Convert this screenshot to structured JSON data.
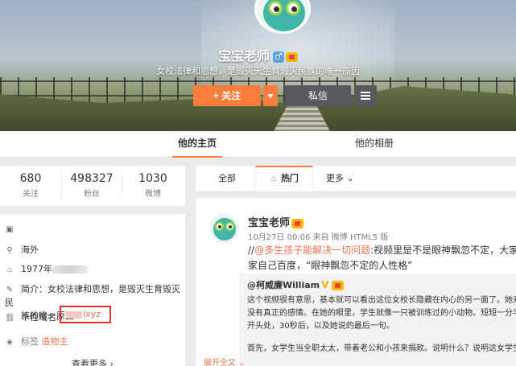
{
  "profile": {
    "name": "宝宝老师",
    "gender": "♂",
    "description": "女校法律和思想，是毁灭天生育毁灭民族的唯一原因",
    "follow_label": "+ 关注",
    "message_label": "私信"
  },
  "tabs": {
    "home": "他的主页",
    "album": "他的相册"
  },
  "stats": [
    {
      "num": "680",
      "label": "关注"
    },
    {
      "num": "498327",
      "label": "粉丝"
    },
    {
      "num": "1030",
      "label": "微博"
    }
  ],
  "info": {
    "location": "海外",
    "birth": "1977年",
    "intro_label": "简介：",
    "intro": "女校法律和思想，是毁灭生育毁灭民",
    "intro_line2": "族的唯一原因",
    "domain_label": "个性域名:",
    "domain_value": "ixyz",
    "tag_label": "标签",
    "tag_value": "造物主",
    "more": "查看更多 ›"
  },
  "feed_nav": {
    "all": "全部",
    "hot": "热门",
    "more": "更多 ⌄"
  },
  "post": {
    "name": "宝宝老师",
    "meta": "10月27日 00:06 来自 微博 HTML5 版",
    "text_prefix": "//",
    "text_link": "@多生孩子能解决一切问题",
    "text_rest": ":视频里是不是眼神飘忽不定，大家自己看",
    "text_line2": "家自己百度，“眼神飘忽不定的人性格”",
    "repost": {
      "author": "@柯威廉William",
      "vip": "V",
      "line1": "这个视频很有意思，基本就可以看出这位女校长隐藏在内心的另一面了。她对自",
      "line2": "没有真正的感情。在她的眼里，学生就像一只被训练过的小动物。短短一分半钟，",
      "line3": "开头处，30秒后，以及她说的最后一句。",
      "line4": "首先，女学生当全职太太，带着老公和小孩来捐款。说明什么？说明这女学生家庭",
      "expand": "展开全文 ⌄"
    }
  },
  "colors": {
    "accent": "#fa7d3c",
    "link": "#eb7350",
    "dark_button": "#585a5d",
    "highlight_box": "#e0312b"
  }
}
